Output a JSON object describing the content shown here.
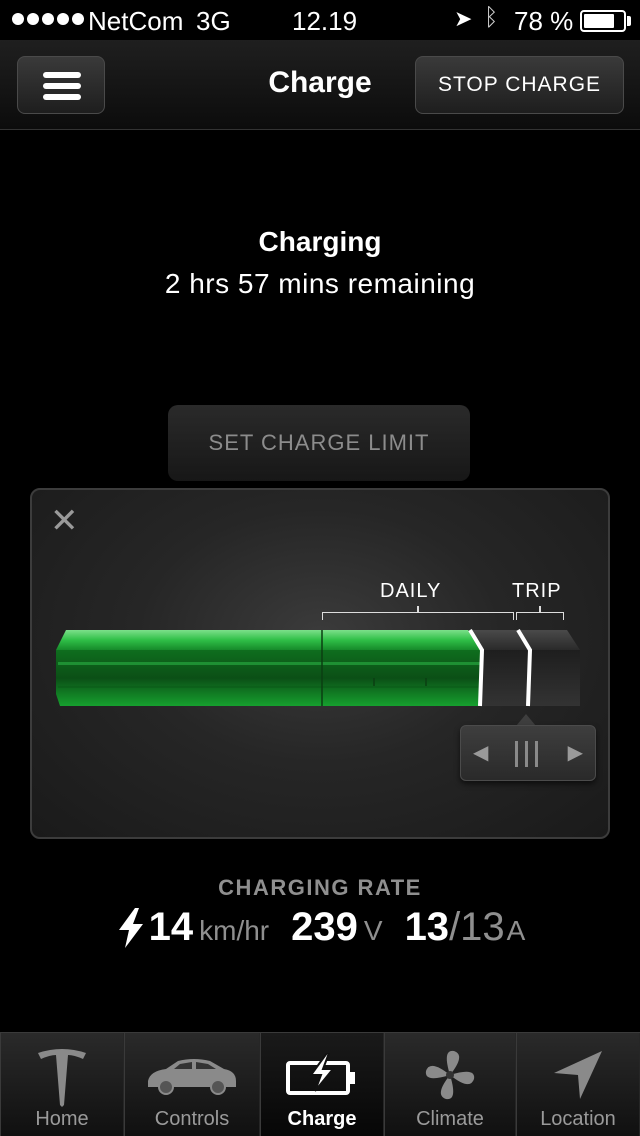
{
  "status_bar": {
    "carrier": "NetCom",
    "network": "3G",
    "time": "12.19",
    "battery_text": "78 %",
    "battery_level": 0.78
  },
  "header": {
    "title": "Charge",
    "stop_label": "STOP CHARGE"
  },
  "charge": {
    "status": "Charging",
    "remaining": "2 hrs 57 mins remaining",
    "set_limit_label": "SET CHARGE LIMIT",
    "level": 0.78,
    "labels": {
      "daily": "DAILY",
      "trip": "TRIP"
    }
  },
  "rate": {
    "title": "CHARGING RATE",
    "speed": "14",
    "speed_unit": "km/hr",
    "voltage": "239",
    "voltage_unit": "V",
    "current": "13",
    "current_max": "/13",
    "current_unit": "A"
  },
  "tabs": [
    {
      "label": "Home",
      "icon": "tesla-logo-icon",
      "active": false
    },
    {
      "label": "Controls",
      "icon": "car-icon",
      "active": false
    },
    {
      "label": "Charge",
      "icon": "charge-battery-icon",
      "active": true
    },
    {
      "label": "Climate",
      "icon": "fan-icon",
      "active": false
    },
    {
      "label": "Location",
      "icon": "location-arrow-icon",
      "active": false
    }
  ],
  "colors": {
    "charge_green": "#1fae3a",
    "background": "#000000",
    "muted_text": "#8f8f8f"
  }
}
